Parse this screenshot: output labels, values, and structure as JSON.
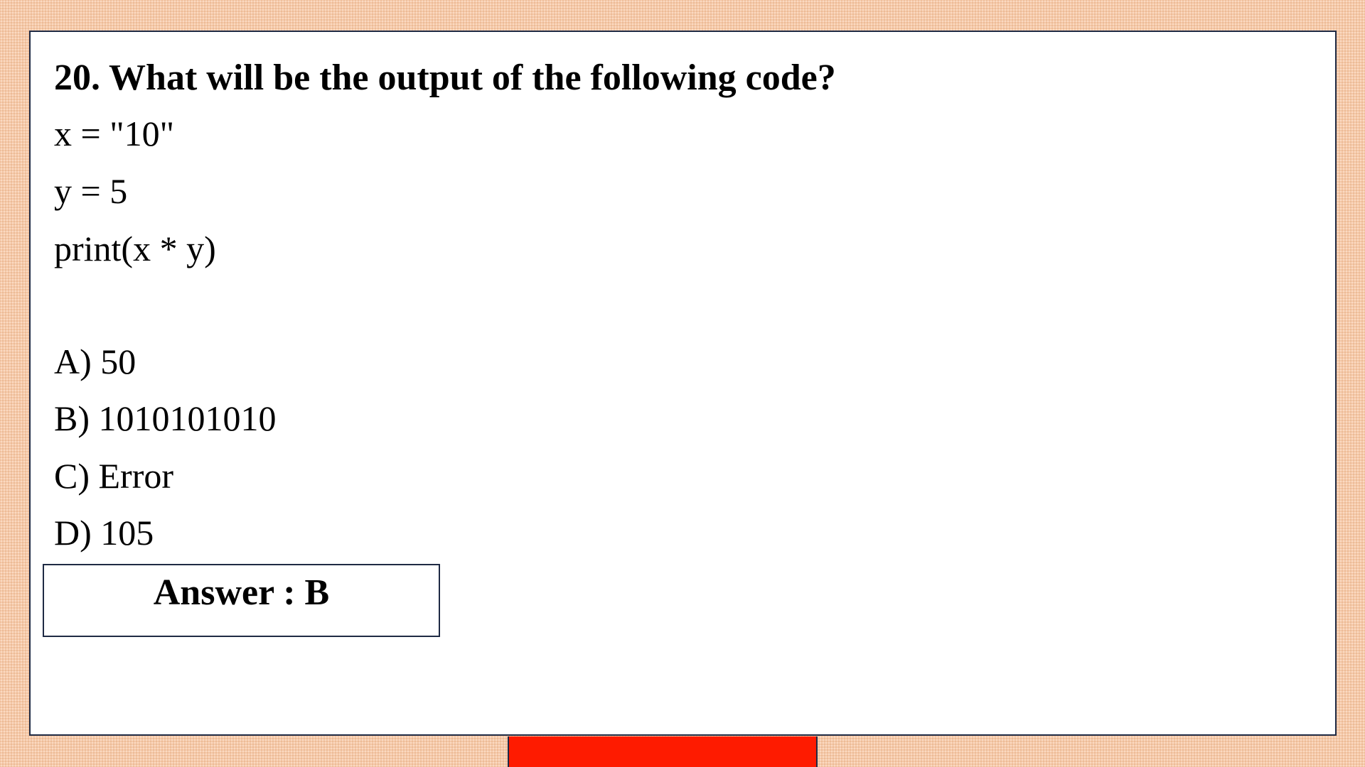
{
  "question": {
    "title": "20. What will be the output of the following code?"
  },
  "code": {
    "lines": [
      "x = \"10\"",
      "y = 5",
      "print(x * y)"
    ]
  },
  "options": [
    "A) 50",
    "B) 1010101010",
    "C) Error",
    "D) 105"
  ],
  "answer": {
    "text": "Answer : B"
  },
  "colors": {
    "background": "#f6c9a8",
    "panel": "#ffffff",
    "border": "#1f2a44",
    "accent_bar": "#fe1b00"
  }
}
